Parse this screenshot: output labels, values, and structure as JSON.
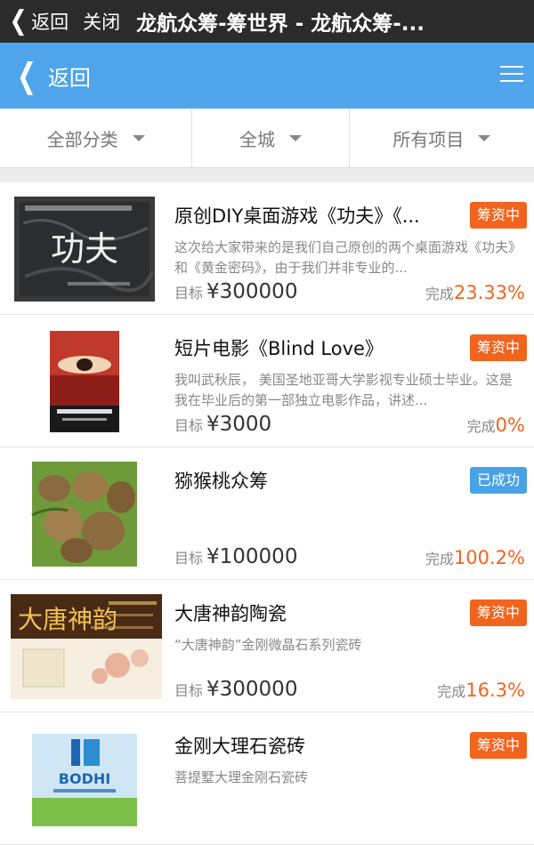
{
  "titlebar": {
    "back_label": "返回",
    "close_label": "关闭",
    "title": "龙航众筹-筹世界 - 龙航众筹-..."
  },
  "navbar": {
    "back_label": "返回"
  },
  "filters": [
    {
      "label": "全部分类"
    },
    {
      "label": "全城"
    },
    {
      "label": "所有项目"
    }
  ],
  "labels": {
    "target": "目标",
    "done": "完成"
  },
  "projects": [
    {
      "name": "原创DIY桌面游戏《功夫》《...",
      "status": "筹资中",
      "status_color": "#f0641e",
      "desc": "这次给大家带来的是我们自己原创的两个桌面游戏《功夫》和《黄金密码》，由于我们并非专业的...",
      "target": "¥300000",
      "progress": "23.33%",
      "thumb_icon": "kungfu-poster-image"
    },
    {
      "name": "短片电影《Blind Love》",
      "status": "筹资中",
      "status_color": "#f0641e",
      "desc": "我叫武秋辰， 美国圣地亚哥大学影视专业硕士毕业。这是我在毕业后的第一部独立电影作品，讲述...",
      "target": "¥3000",
      "progress": "0%",
      "thumb_icon": "movie-poster-image"
    },
    {
      "name": "猕猴桃众筹",
      "status": "已成功",
      "status_color": "#4aa2e6",
      "desc": "",
      "target": "¥100000",
      "progress": "100.2%",
      "thumb_icon": "kiwi-fruit-image"
    },
    {
      "name": "大唐神韵陶瓷",
      "status": "筹资中",
      "status_color": "#f0641e",
      "desc": "“大唐神韵”金刚微晶石系列瓷砖",
      "target": "¥300000",
      "progress": "16.3%",
      "thumb_icon": "ceramic-banner-image"
    },
    {
      "name": "金刚大理石瓷砖",
      "status": "筹资中",
      "status_color": "#f0641e",
      "desc": "菩提墅大理金刚石瓷砖",
      "target": "",
      "progress": "",
      "thumb_icon": "bodhi-logo-image"
    }
  ],
  "thumb_text": {
    "kungfu": "功夫",
    "bodhi": "BODHI",
    "datang": "大唐神韵"
  }
}
